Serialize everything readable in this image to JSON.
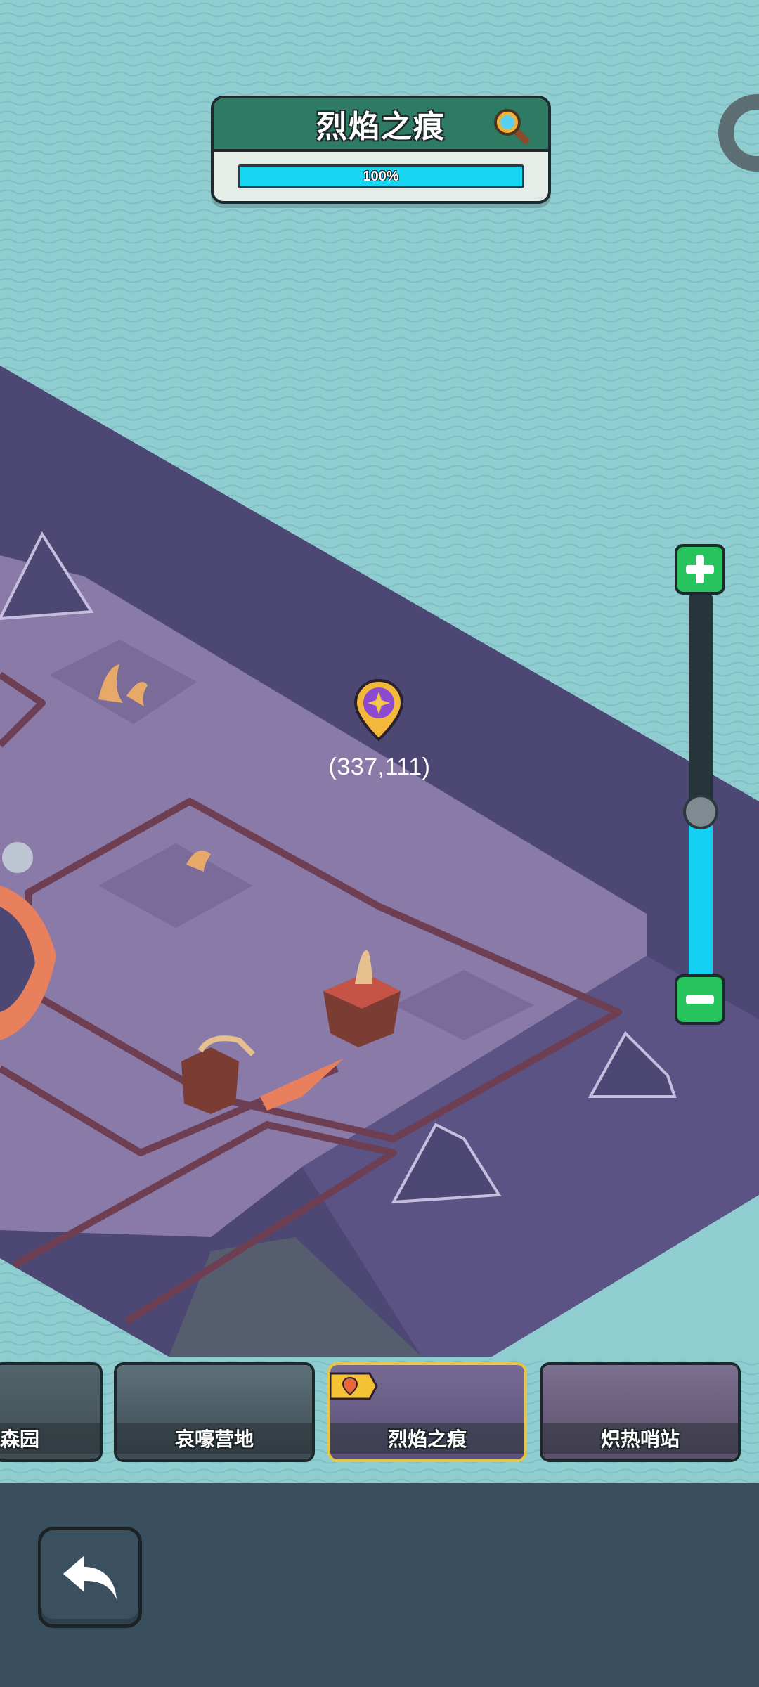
{
  "header": {
    "title": "烈焰之痕",
    "progress_text": "100%",
    "progress": 1.0
  },
  "map": {
    "coordinates": "(337,111)"
  },
  "zoom": {
    "level": 0.43
  },
  "zones": [
    {
      "label": "森园",
      "selected": false
    },
    {
      "label": "哀嚎营地",
      "selected": false
    },
    {
      "label": "烈焰之痕",
      "selected": true
    },
    {
      "label": "炽热哨站",
      "selected": false
    }
  ],
  "colors": {
    "water": "#8fcdd1",
    "land_dark": "#4d4773",
    "land_top": "#8a7aa8",
    "accent_cyan": "#16d6f4",
    "accent_green": "#27c35c",
    "selected_border": "#e9c546",
    "bottom_bar": "#3a4f5d"
  },
  "icons": {
    "search": "magnifier-icon",
    "zoom_in": "plus-icon",
    "zoom_out": "minus-icon",
    "location": "location-pin-icon",
    "back": "back-arrow-icon"
  }
}
